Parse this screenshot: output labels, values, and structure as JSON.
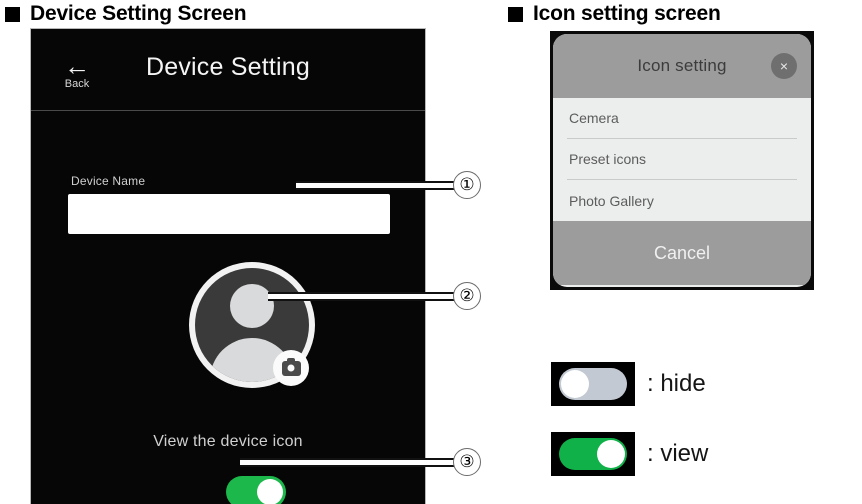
{
  "sections": {
    "device": {
      "heading": "Device Setting Screen"
    },
    "icon": {
      "heading": "Icon setting screen"
    }
  },
  "phone": {
    "back": {
      "arrow": "←",
      "label": "Back"
    },
    "title": "Device Setting",
    "device_name": {
      "label": "Device Name",
      "value": "",
      "placeholder": ""
    },
    "avatar": {
      "camera_badge": "camera-icon"
    },
    "view_icon": {
      "label": "View the device icon",
      "toggle_state": "on",
      "toggle_color": "#1cb84b"
    }
  },
  "callouts": [
    {
      "number": "①",
      "target": "device-name-input"
    },
    {
      "number": "②",
      "target": "device-icon-avatar"
    },
    {
      "number": "③",
      "target": "view-device-icon-toggle"
    }
  ],
  "dialog": {
    "title": "Icon setting",
    "close": "×",
    "items": [
      {
        "label": "Cemera"
      },
      {
        "label": "Preset icons"
      },
      {
        "label": "Photo Gallery"
      }
    ],
    "cancel": "Cancel"
  },
  "legend": [
    {
      "state": "off",
      "text": ": hide",
      "color": "#c2c9d2"
    },
    {
      "state": "on",
      "text": ": view",
      "color": "#11b14a"
    }
  ]
}
